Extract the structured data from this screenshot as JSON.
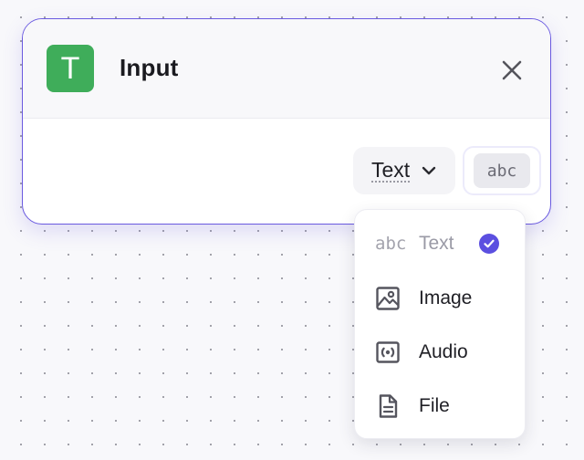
{
  "node": {
    "icon_letter": "T",
    "title": "Input",
    "close_icon": "close-icon",
    "type_select": {
      "selected": "Text",
      "icon": "chevron-down-icon"
    },
    "type_badge": "abc"
  },
  "dropdown": {
    "options": [
      {
        "label": "Text",
        "icon": "abc",
        "selected": true
      },
      {
        "label": "Image",
        "icon": "image-icon",
        "selected": false
      },
      {
        "label": "Audio",
        "icon": "audio-icon",
        "selected": false
      },
      {
        "label": "File",
        "icon": "file-icon",
        "selected": false
      }
    ]
  },
  "colors": {
    "accent": "#6a5ae0",
    "node_icon_bg": "#3fad5a",
    "check": "#5b4fe0"
  }
}
